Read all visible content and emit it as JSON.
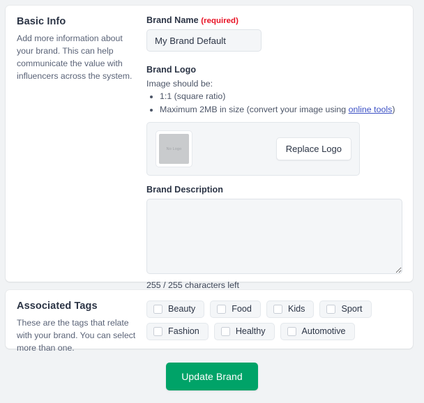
{
  "basic_info": {
    "title": "Basic Info",
    "description": "Add more information about your brand. This can help communicate the value with influencers across the system.",
    "brand_name": {
      "label": "Brand Name",
      "required_note": "(required)",
      "value": "My Brand Default",
      "placeholder": ""
    },
    "brand_logo": {
      "label": "Brand Logo",
      "hint_intro": "Image should be:",
      "hints": [
        "1:1 (square ratio)",
        "Maximum 2MB in size (convert your image using online tools)"
      ],
      "hint_2_prefix": "Maximum 2MB in size (convert your image using ",
      "hint_2_link": "online tools",
      "hint_2_suffix": ")",
      "thumbnail_text": "No Logo",
      "replace_button": "Replace Logo"
    },
    "brand_description": {
      "label": "Brand Description",
      "value": "",
      "placeholder": "",
      "counter": "255 / 255 characters left"
    }
  },
  "associated_tags": {
    "title": "Associated Tags",
    "description": "These are the tags that relate with your brand. You can select more than one.",
    "rows": [
      [
        {
          "label": "Beauty",
          "checked": false
        },
        {
          "label": "Food",
          "checked": false
        },
        {
          "label": "Kids",
          "checked": false
        },
        {
          "label": "Sport",
          "checked": false
        }
      ],
      [
        {
          "label": "Fashion",
          "checked": false
        },
        {
          "label": "Healthy",
          "checked": false
        },
        {
          "label": "Automotive",
          "checked": false
        }
      ]
    ]
  },
  "submit": {
    "label": "Update Brand",
    "color": "#00a368"
  },
  "colors": {
    "page_background": "#f1f3f5",
    "card_background": "#ffffff",
    "input_background": "#f4f6f8",
    "required_red": "#e81123",
    "link_blue": "#3a4fc4",
    "text_primary": "#2b3445",
    "text_secondary": "#5a6377"
  }
}
